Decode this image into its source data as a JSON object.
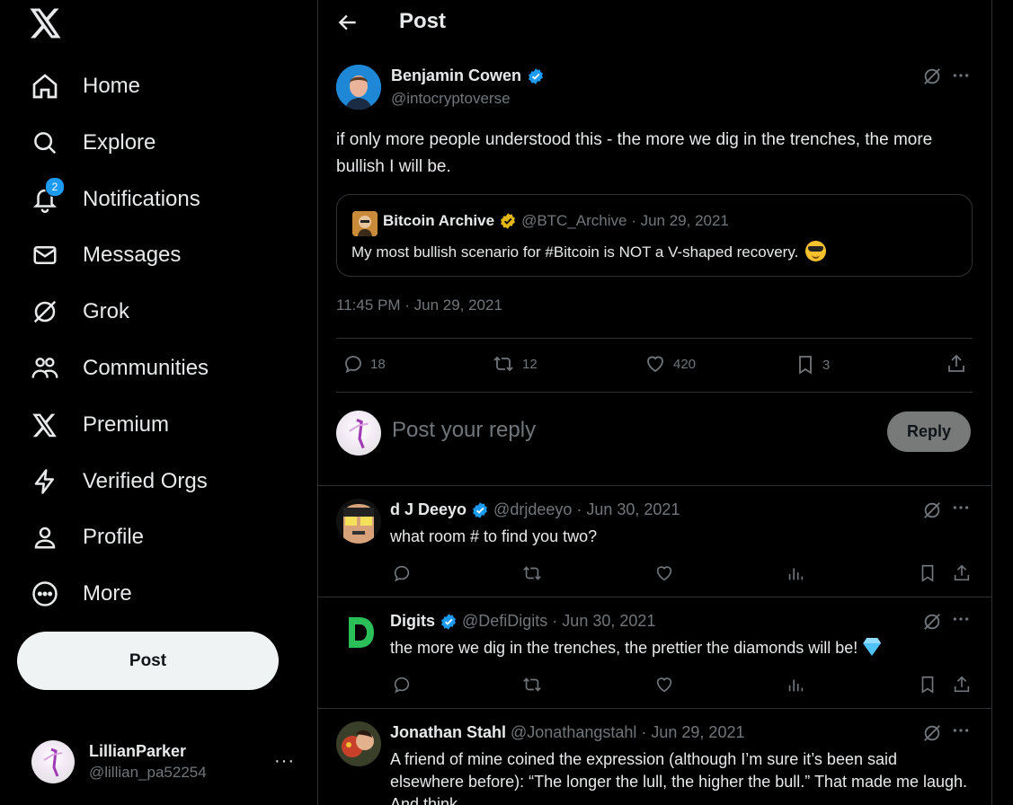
{
  "sidebar": {
    "items": [
      {
        "label": "Home",
        "icon": "home-icon"
      },
      {
        "label": "Explore",
        "icon": "search-icon"
      },
      {
        "label": "Notifications",
        "icon": "bell-icon",
        "badge": "2"
      },
      {
        "label": "Messages",
        "icon": "mail-icon"
      },
      {
        "label": "Grok",
        "icon": "grok-icon"
      },
      {
        "label": "Communities",
        "icon": "communities-icon"
      },
      {
        "label": "Premium",
        "icon": "x-logo-icon"
      },
      {
        "label": "Verified Orgs",
        "icon": "lightning-icon"
      },
      {
        "label": "Profile",
        "icon": "person-icon"
      },
      {
        "label": "More",
        "icon": "more-circle-icon"
      }
    ],
    "post_label": "Post",
    "account": {
      "name": "LillianParker",
      "handle": "@lillian_pa52254",
      "more": "···"
    }
  },
  "header": {
    "title": "Post"
  },
  "tweet": {
    "author": "Benjamin Cowen",
    "handle": "@intocryptoverse",
    "text": "if only more people understood this - the more we dig in the trenches, the more bullish I will be.",
    "quote": {
      "author": "Bitcoin Archive",
      "meta": "@BTC_Archive · Jun 29, 2021",
      "text": "My most bullish scenario for #Bitcoin is NOT a V-shaped recovery."
    },
    "timestamp": "11:45 PM · Jun 29, 2021",
    "stats": {
      "replies": "18",
      "reposts": "12",
      "likes": "420",
      "bookmarks": "3"
    }
  },
  "composer": {
    "placeholder": "Post your reply",
    "button": "Reply"
  },
  "replies": [
    {
      "name": "d J Deeyo",
      "meta": "@drjdeeyo · Jun 30, 2021",
      "text": "what room # to find you two?"
    },
    {
      "name": "Digits",
      "meta": "@DefiDigits · Jun 30, 2021",
      "text": "the more we dig in the trenches, the prettier the diamonds will be!"
    },
    {
      "name": "Jonathan Stahl",
      "meta": "@Jonathangstahl · Jun 29, 2021",
      "text": "A friend of mine coined the expression (although I’m sure it’s been said elsewhere before): “The longer the lull, the higher the bull.” That made me laugh. And think."
    }
  ],
  "colors": {
    "accent": "#1d9bf0",
    "gold": "#e2b719",
    "muted": "#71767b",
    "border": "#2f3336"
  }
}
